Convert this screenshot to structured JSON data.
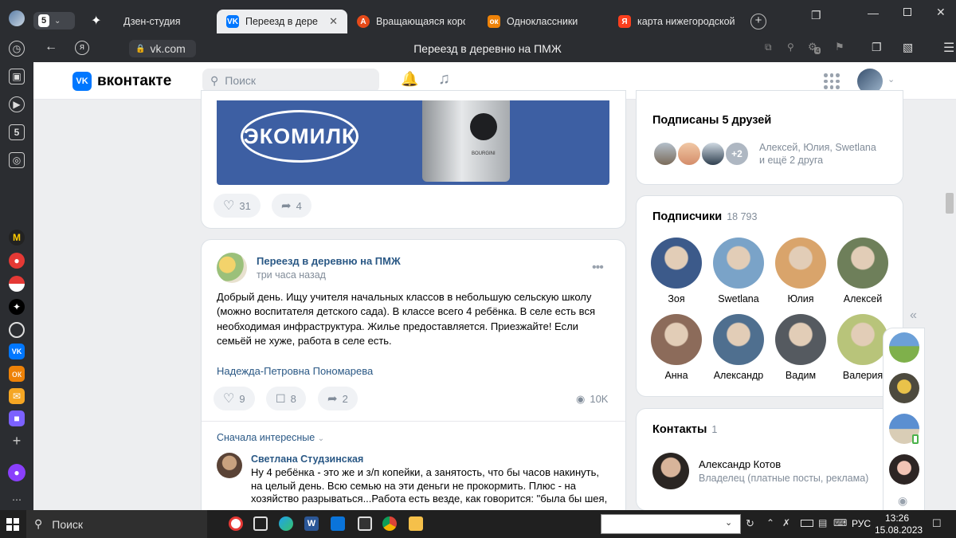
{
  "browser": {
    "tabs": [
      {
        "label": "Дзен-студия",
        "icon": "dzen-icon",
        "color": "#000000"
      },
      {
        "label": "Переезд в деревню на ПМЖ",
        "icon": "vk-icon",
        "color": "#0077ff",
        "active": true
      },
      {
        "label": "Вращающаяся коробка",
        "icon": "coin-icon",
        "color": "#e64a19"
      },
      {
        "label": "Одноклассники",
        "icon": "ok-icon",
        "color": "#ee8208"
      },
      {
        "label": "карта нижегородской о",
        "icon": "yandex-icon",
        "color": "#fc3f1d"
      }
    ],
    "tab_count_badge": "5",
    "address": "vk.com",
    "page_title": "Переезд в деревню на ПМЖ",
    "extension_badge": "4"
  },
  "vk": {
    "logo_text": "вконтакте",
    "search_placeholder": "Поиск",
    "ad_text": "ЭКОМИЛК",
    "ad_brand": "BOURGINI",
    "prev_post": {
      "likes": "31",
      "shares": "4"
    },
    "post": {
      "author": "Переезд в деревню на ПМЖ",
      "time": "три часа назад",
      "text": "Добрый день. Ищу учителя начальных классов в небольшую сельскую школу (можно воспитателя детского сада). В классе всего 4 ребёнка. В селе есть вся необходимая инфраструктура. Жилье предоставляется. Приезжайте! Если семьёй не хуже, работа в селе есть.",
      "signature": "Надежда-Петровна Пономарева",
      "likes": "9",
      "comments": "8",
      "shares": "2",
      "views": "10K",
      "sort_label": "Сначала интересные"
    },
    "comment": {
      "author": "Светлана Студзинская",
      "text": "Ну 4 ребёнка - это же и з/п копейки, а занятость, что бы часов накинуть, на целый день. Всю семью на эти деньги не прокормить. Плюс - на хозяйство разрываться...Работа есть везде, как говорится: \"была бы шея, хомут"
    },
    "friends_subscribed": {
      "title": "Подписаны 5 друзей",
      "plus": "+2",
      "names": "Алексей, Юлия, Swetlana",
      "more": "и ещё 2 друга"
    },
    "subscribers": {
      "title": "Подписчики",
      "count": "18 793",
      "people": [
        {
          "name": "Зоя",
          "color": "#3c5a8a"
        },
        {
          "name": "Swetlana",
          "color": "#7aa3c8"
        },
        {
          "name": "Юлия",
          "color": "#d9a46b"
        },
        {
          "name": "Алексей",
          "color": "#6e7f5a"
        },
        {
          "name": "Анна",
          "color": "#8c6b5a"
        },
        {
          "name": "Александр",
          "color": "#4f6f8f"
        },
        {
          "name": "Вадим",
          "color": "#555a60"
        },
        {
          "name": "Валерия",
          "color": "#b8c47a"
        }
      ]
    },
    "contacts": {
      "title": "Контакты",
      "count": "1",
      "name": "Александр Котов",
      "role": "Владелец (платные посты, реклама)"
    }
  },
  "taskbar": {
    "search_label": "Поиск",
    "lang": "РУС",
    "time": "13:26",
    "date": "15.08.2023"
  }
}
